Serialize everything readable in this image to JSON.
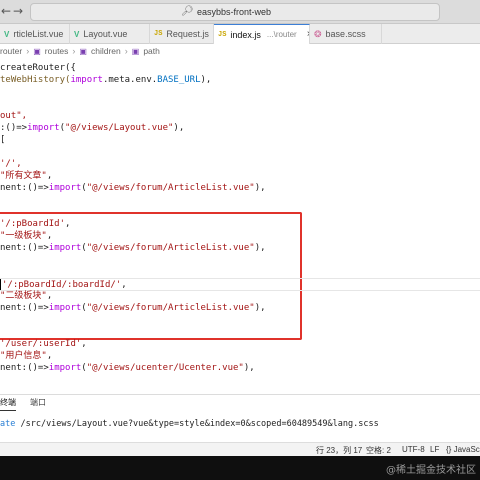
{
  "window": {
    "search_text": "easybbs-front-web",
    "nav_back": "←",
    "nav_forward": "→",
    "search_icon": "search-icon"
  },
  "tabs": [
    {
      "label": "rticleList.vue",
      "icon": "vue-icon",
      "active": false
    },
    {
      "label": "Layout.vue",
      "icon": "vue-icon",
      "active": false
    },
    {
      "label": "Request.js",
      "icon": "js-icon",
      "active": false
    },
    {
      "label": "index.js",
      "path": "...\\router",
      "icon": "js-icon",
      "active": true,
      "close": "×"
    },
    {
      "label": "base.scss",
      "icon": "scss-icon",
      "active": false
    }
  ],
  "breadcrumb": [
    "router",
    "routes",
    "children",
    "path"
  ],
  "code": [
    {
      "parts": [
        [
          "createRouter({",
          "#1f1f1f"
        ]
      ]
    },
    {
      "parts": [
        [
          "teWebHistory(",
          "#795e26"
        ],
        [
          "import",
          "#af00db"
        ],
        [
          ".meta.env.",
          "#1f1f1f"
        ],
        [
          "BASE_URL",
          "#0070c1"
        ],
        [
          "),",
          "#1f1f1f"
        ]
      ]
    },
    {
      "parts": []
    },
    {
      "parts": []
    },
    {
      "parts": [
        [
          "out\",",
          "#a31515"
        ]
      ]
    },
    {
      "parts": [
        [
          ":()=>",
          "#1f1f1f"
        ],
        [
          "import",
          "#af00db"
        ],
        [
          "(",
          "#1f1f1f"
        ],
        [
          "\"@/views/Layout.vue\"",
          "#a31515"
        ],
        [
          "),",
          "#1f1f1f"
        ]
      ]
    },
    {
      "parts": [
        [
          "[",
          "#1f1f1f"
        ]
      ]
    },
    {
      "parts": []
    },
    {
      "parts": [
        [
          "'/',",
          "#a31515"
        ]
      ]
    },
    {
      "parts": [
        [
          "\"所有文章\"",
          "#a31515"
        ],
        [
          ",",
          "#1f1f1f"
        ]
      ]
    },
    {
      "parts": [
        [
          "nent:()=>",
          "#1f1f1f"
        ],
        [
          "import",
          "#af00db"
        ],
        [
          "(",
          "#1f1f1f"
        ],
        [
          "\"@/views/forum/ArticleList.vue\"",
          "#a31515"
        ],
        [
          "),",
          "#1f1f1f"
        ]
      ]
    },
    {
      "parts": []
    },
    {
      "parts": []
    },
    {
      "parts": [
        [
          "'/:pBoardId'",
          "#a31515"
        ],
        [
          ",",
          "#1f1f1f"
        ]
      ]
    },
    {
      "parts": [
        [
          "\"一级板块\"",
          "#a31515"
        ],
        [
          ",",
          "#1f1f1f"
        ]
      ]
    },
    {
      "parts": [
        [
          "nent:()=>",
          "#1f1f1f"
        ],
        [
          "import",
          "#af00db"
        ],
        [
          "(",
          "#1f1f1f"
        ],
        [
          "\"@/views/forum/ArticleList.vue\"",
          "#a31515"
        ],
        [
          "),",
          "#1f1f1f"
        ]
      ]
    },
    {
      "parts": []
    },
    {
      "parts": []
    },
    {
      "parts": [
        [
          "'/:pBoardId/:boardId/'",
          "#a31515"
        ],
        [
          ",",
          "#1f1f1f"
        ]
      ],
      "cursor": true
    },
    {
      "parts": [
        [
          "\"二级板块\"",
          "#a31515"
        ],
        [
          ",",
          "#1f1f1f"
        ]
      ]
    },
    {
      "parts": [
        [
          "nent:()=>",
          "#1f1f1f"
        ],
        [
          "import",
          "#af00db"
        ],
        [
          "(",
          "#1f1f1f"
        ],
        [
          "\"@/views/forum/ArticleList.vue\"",
          "#a31515"
        ],
        [
          "),",
          "#1f1f1f"
        ]
      ]
    },
    {
      "parts": []
    },
    {
      "parts": []
    },
    {
      "parts": [
        [
          "'/user/:userId'",
          "#a31515"
        ],
        [
          ",",
          "#1f1f1f"
        ]
      ]
    },
    {
      "parts": [
        [
          "\"用户信息\"",
          "#a31515"
        ],
        [
          ",",
          "#1f1f1f"
        ]
      ]
    },
    {
      "parts": [
        [
          "nent:()=>",
          "#1f1f1f"
        ],
        [
          "import",
          "#af00db"
        ],
        [
          "(",
          "#1f1f1f"
        ],
        [
          "\"@/views/ucenter/Ucenter.vue\"",
          "#a31515"
        ],
        [
          "),",
          "#1f1f1f"
        ]
      ]
    }
  ],
  "panel": {
    "tabs": [
      "终端",
      "端口"
    ],
    "output_prefix": "ate",
    "output_text": " /src/views/Layout.vue?vue&type=style&index=0&scoped=60489549&lang.scss"
  },
  "status": {
    "position": "行 23，列 17",
    "spaces": "空格: 2",
    "encoding": "UTF-8",
    "eol": "LF",
    "language": "{} JavaSc"
  },
  "watermark": "@稀土掘金技术社区",
  "colors": {
    "highlight_box": "#e0322b",
    "active_tab_border": "#3c7fd6"
  }
}
